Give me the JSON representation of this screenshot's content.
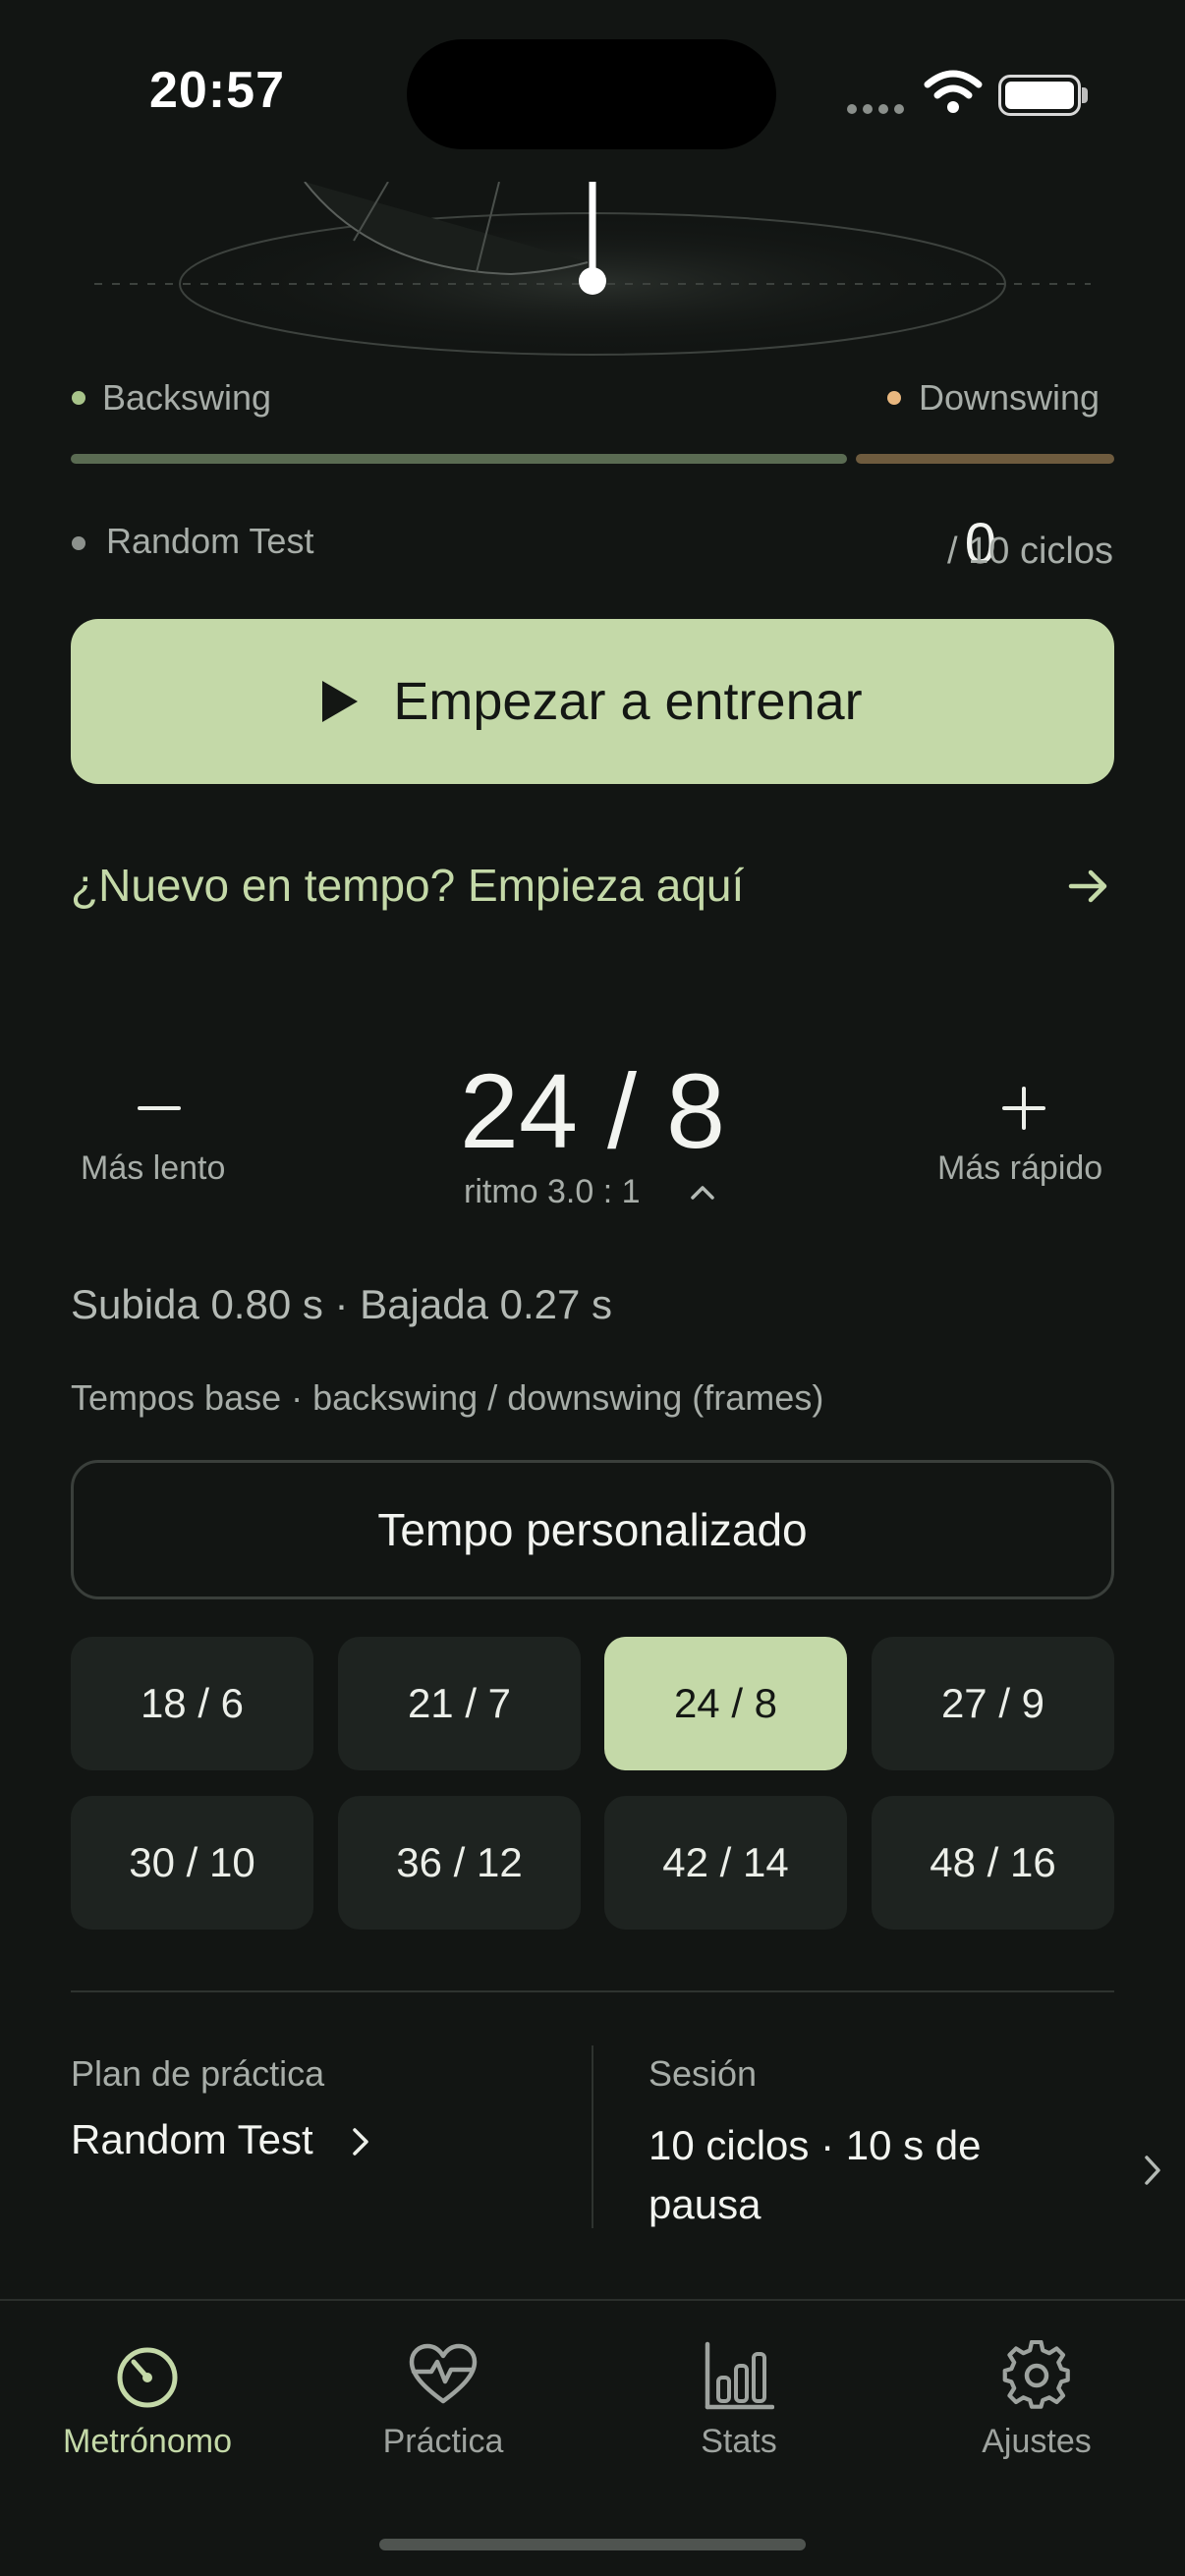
{
  "status_bar": {
    "time": "20:57"
  },
  "legend": {
    "backswing": "Backswing",
    "downswing": "Downswing"
  },
  "colors": {
    "accent": "#C4D9A8",
    "backswing": "#A8C48A",
    "downswing": "#E8B77F",
    "background": "#121513"
  },
  "progress": {
    "plan_name": "Random Test",
    "cycles_done": "0",
    "cycles_total_text": "/ 10 ciclos"
  },
  "start_button": {
    "label": "Empezar a entrenar",
    "icon": "play-icon"
  },
  "intro_link": {
    "label": "¿Nuevo en tempo? Empieza aquí",
    "icon": "arrow-right-icon"
  },
  "tempo": {
    "slower_label": "Más lento",
    "faster_label": "Más rápido",
    "current": "24 / 8",
    "ratio": "ritmo 3.0 : 1"
  },
  "timing_text": "Subida 0.80 s · Bajada 0.27 s",
  "tempos_section_label": "Tempos base · backswing / downswing (frames)",
  "custom_tempo_label": "Tempo personalizado",
  "tempo_chips": [
    "18 / 6",
    "21 / 7",
    "24 / 8",
    "27 / 9",
    "30 / 10",
    "36 / 12",
    "42 / 14",
    "48 / 16"
  ],
  "selected_tempo": "24 / 8",
  "plan": {
    "caption": "Plan de práctica",
    "value": "Random Test"
  },
  "session": {
    "caption": "Sesión",
    "value": "10 ciclos · 10 s de pausa"
  },
  "tabs": [
    {
      "label": "Metrónomo",
      "icon": "metronome-icon",
      "active": true
    },
    {
      "label": "Práctica",
      "icon": "heart-pulse-icon",
      "active": false
    },
    {
      "label": "Stats",
      "icon": "bar-chart-icon",
      "active": false
    },
    {
      "label": "Ajustes",
      "icon": "gear-icon",
      "active": false
    }
  ]
}
